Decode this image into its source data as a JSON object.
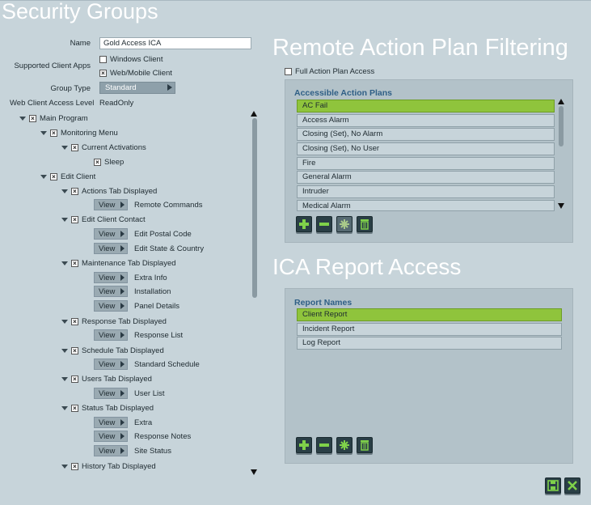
{
  "titles": {
    "security_groups": "Security Groups",
    "remote_action_plan": "Remote Action Plan Filtering",
    "ica_report": "ICA Report Access"
  },
  "form": {
    "name_label": "Name",
    "name_value": "Gold Access ICA",
    "supported_label": "Supported Client Apps",
    "windows_client": "Windows Client",
    "windows_checked": "",
    "web_mobile_client": "Web/Mobile Client",
    "web_mobile_checked": "×",
    "group_type_label": "Group Type",
    "group_type_value": "Standard",
    "web_access_label": "Web Client Access Level",
    "web_access_value": "ReadOnly"
  },
  "tree": {
    "check_mark": "×",
    "main_program": "Main Program",
    "monitoring_menu": "Monitoring Menu",
    "current_activations": "Current Activations",
    "sleep": "Sleep",
    "edit_client": "Edit Client",
    "actions_tab": "Actions Tab Displayed",
    "remote_commands": "Remote Commands",
    "edit_client_contact": "Edit Client Contact",
    "edit_postal_code": "Edit Postal Code",
    "edit_state_country": "Edit State & Country",
    "maintenance_tab": "Maintenance Tab Displayed",
    "extra_info": "Extra Info",
    "installation": "Installation",
    "panel_details": "Panel Details",
    "response_tab": "Response Tab Displayed",
    "response_list": "Response List",
    "schedule_tab": "Schedule Tab Displayed",
    "standard_schedule": "Standard Schedule",
    "users_tab": "Users Tab Displayed",
    "user_list": "User List",
    "status_tab": "Status Tab Displayed",
    "extra": "Extra",
    "response_notes": "Response Notes",
    "site_status": "Site Status",
    "history_tab": "History Tab Displayed",
    "view_label": "View"
  },
  "action_plans": {
    "full_access_label": "Full Action Plan Access",
    "full_access_checked": "",
    "header": "Accessible Action Plans",
    "items": [
      "AC Fail",
      "Access Alarm",
      "Closing (Set), No Alarm",
      "Closing (Set), No User",
      "Fire",
      "General Alarm",
      "Intruder",
      "Medical Alarm"
    ],
    "selected": "AC Fail"
  },
  "reports": {
    "header": "Report Names",
    "items": [
      "Client Report",
      "Incident Report",
      "Log Report"
    ],
    "selected": "Client Report"
  },
  "icons": {
    "add": "plus-icon",
    "remove": "minus-icon",
    "select_all": "asterisk-icon",
    "delete": "trash-icon",
    "save": "save-icon",
    "cancel": "close-icon"
  },
  "colors": {
    "background": "#c7d4da",
    "panel": "#b3c2c9",
    "selected": "#8fc43c",
    "header_text": "#2f5f86",
    "icon_green": "#7fd14a"
  }
}
